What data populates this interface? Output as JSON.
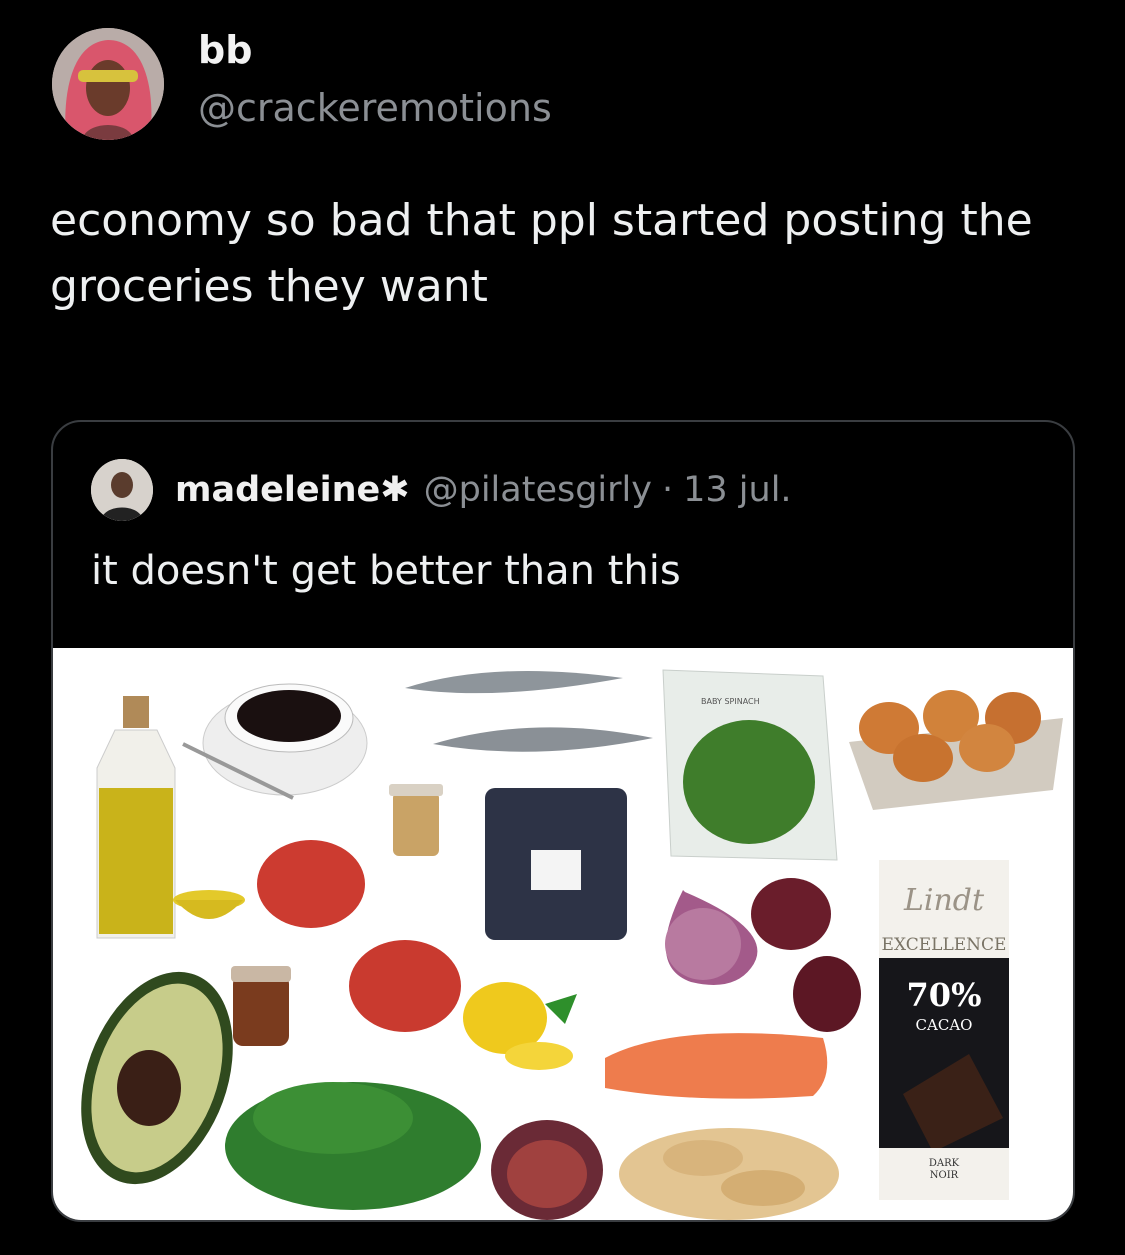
{
  "tweet": {
    "display_name": "bb",
    "handle": "@crackeremotions",
    "text": "economy so bad that ppl started posting the groceries they want"
  },
  "quote": {
    "display_name": "madeleine",
    "name_symbol": "✱",
    "handle": "@pilatesgirly",
    "separator": "·",
    "date": "13 jul.",
    "text": "it doesn't get better than this"
  },
  "image_labels": {
    "chocolate_brand": "Lindt",
    "chocolate_line": "EXCELLENCE",
    "chocolate_percent": "70%",
    "chocolate_cacao": "CACAO",
    "chocolate_dark": "DARK",
    "chocolate_noir": "NOIR",
    "spinach_label": "BABY SPINACH"
  },
  "colors": {
    "background": "#000000",
    "text": "#e7e9ea",
    "muted": "#8b8f94",
    "card_border": "#3a3d41"
  }
}
